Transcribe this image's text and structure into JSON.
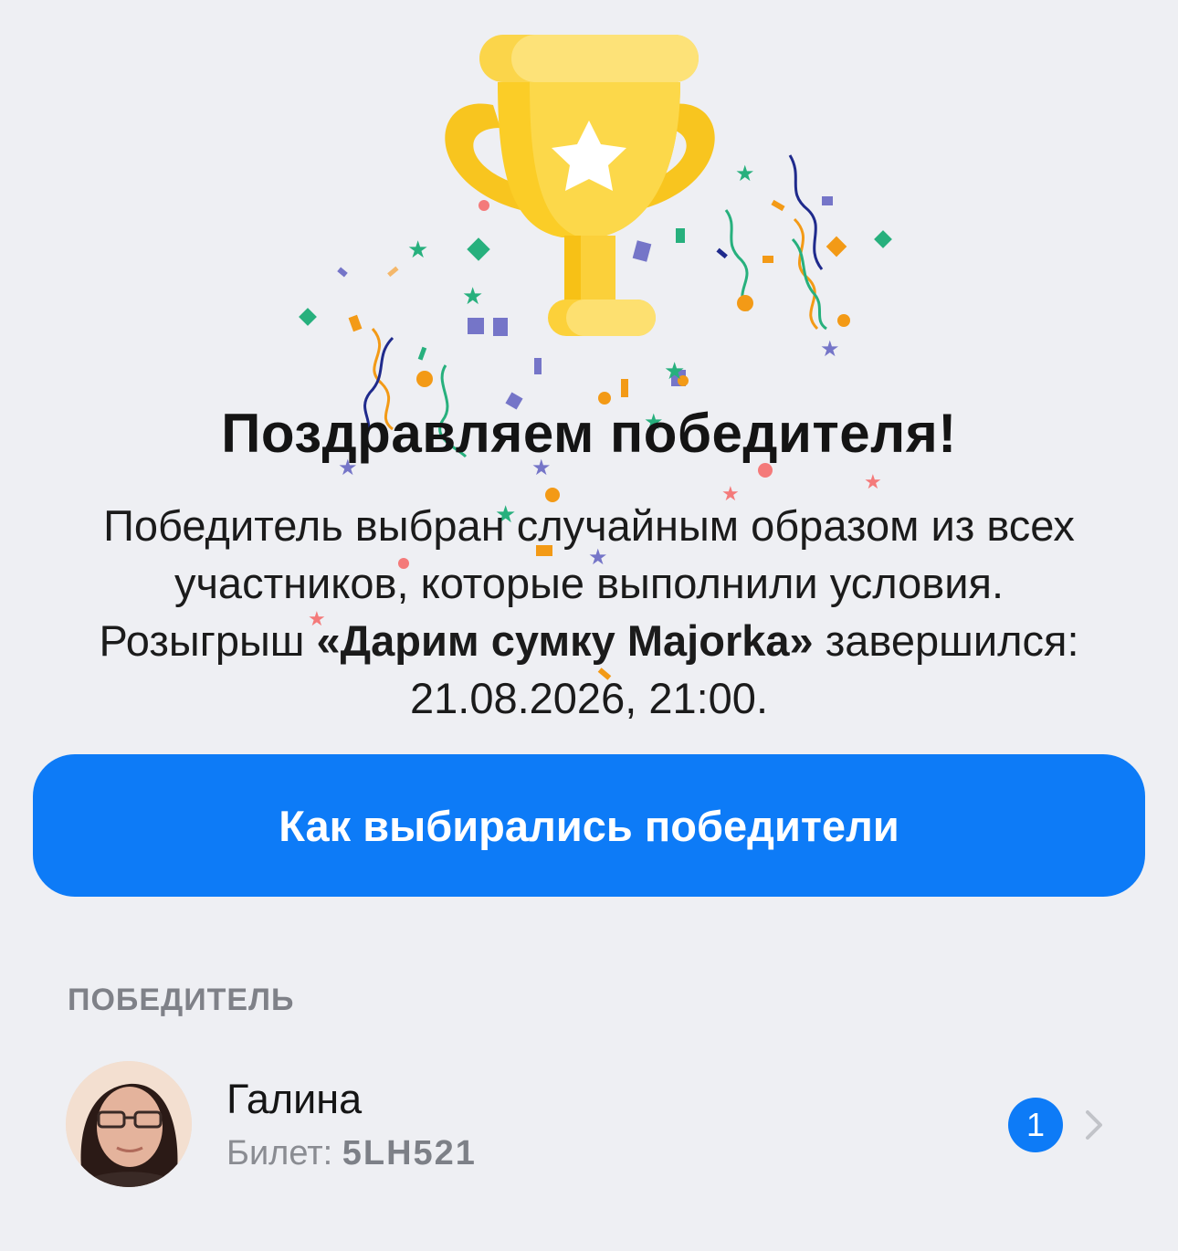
{
  "hero": {
    "title": "Поздравляем победителя!",
    "description_line_1": "Победитель выбран случайным образом из всех",
    "description_line_2": "участников, которые выполнили условия.",
    "description_prefix": "Розыгрыш ",
    "giveaway_name": "«Дарим сумку Majorka»",
    "description_suffix": " завершился:",
    "end_datetime": "21.08.2026, 21:00."
  },
  "button": {
    "label": "Как выбирались победители"
  },
  "winners": {
    "section_label": "ПОБЕДИТЕЛЬ",
    "items": [
      {
        "name": "Галина",
        "ticket_label": "Билет: ",
        "ticket_code": "5LH521",
        "count_badge": "1"
      }
    ]
  },
  "icons": {
    "trophy": "trophy-icon",
    "star": "star-icon",
    "confetti": "confetti-decoration",
    "chevron": "chevron-right-icon",
    "avatar": "user-avatar"
  },
  "colors": {
    "background": "#eeeff3",
    "accent": "#0d7bf7",
    "trophy_gold": "#fcd13a",
    "section_label": "#7f8188"
  }
}
